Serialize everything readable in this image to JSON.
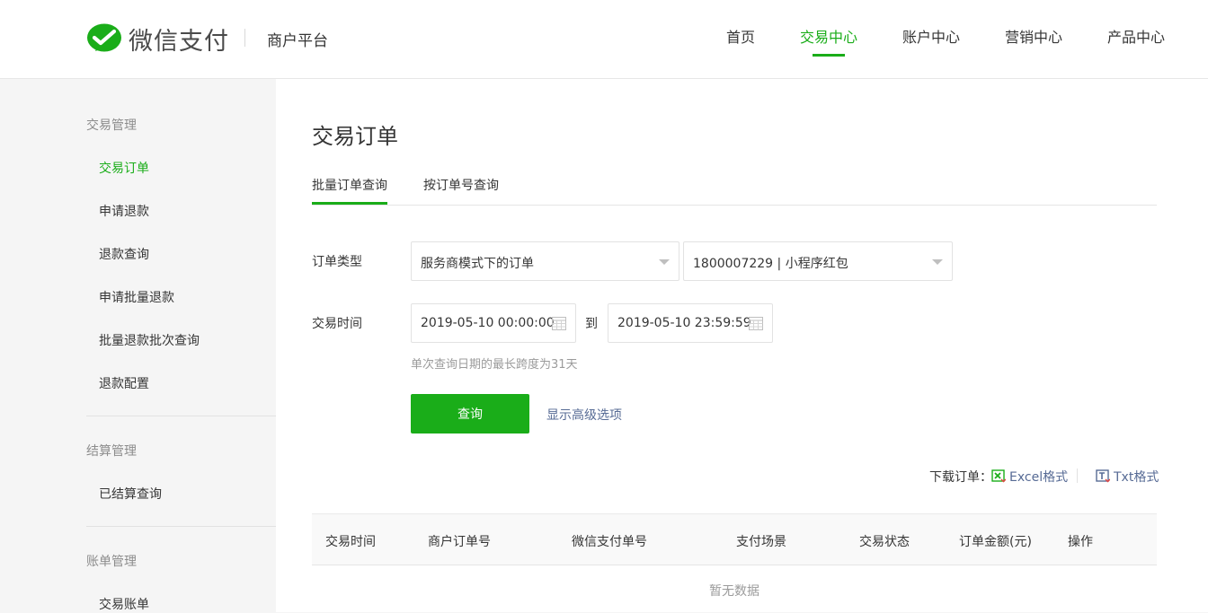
{
  "header": {
    "logo_text": "微信支付",
    "platform": "商户平台",
    "nav": [
      "首页",
      "交易中心",
      "账户中心",
      "营销中心",
      "产品中心"
    ],
    "active_nav": "交易中心"
  },
  "sidebar": {
    "groups": [
      {
        "title": "交易管理",
        "items": [
          "交易订单",
          "申请退款",
          "退款查询",
          "申请批量退款",
          "批量退款批次查询",
          "退款配置"
        ]
      },
      {
        "title": "结算管理",
        "items": [
          "已结算查询"
        ]
      },
      {
        "title": "账单管理",
        "items": [
          "交易账单"
        ]
      }
    ],
    "active_item": "交易订单"
  },
  "main": {
    "title": "交易订单",
    "tabs": [
      "批量订单查询",
      "按订单号查询"
    ],
    "form": {
      "order_type_label": "订单类型",
      "order_type_value": "服务商模式下的订单",
      "merchant_value": "1800007229 | 小程序红包",
      "time_label": "交易时间",
      "start_time": "2019-05-10 00:00:00",
      "to_label": "到",
      "end_time": "2019-05-10 23:59:59",
      "hint": "单次查询日期的最长跨度为31天",
      "query_button": "查询",
      "advanced_link": "显示高级选项"
    },
    "download": {
      "label": "下载订单：",
      "excel": "Excel格式",
      "txt": "Txt格式"
    },
    "table": {
      "columns": [
        "交易时间",
        "商户订单号",
        "微信支付单号",
        "支付场景",
        "交易状态",
        "订单金额(元)",
        "操作"
      ],
      "empty_text": "暂无数据"
    }
  },
  "colors": {
    "accent": "#1aad19",
    "link": "#576b95"
  }
}
